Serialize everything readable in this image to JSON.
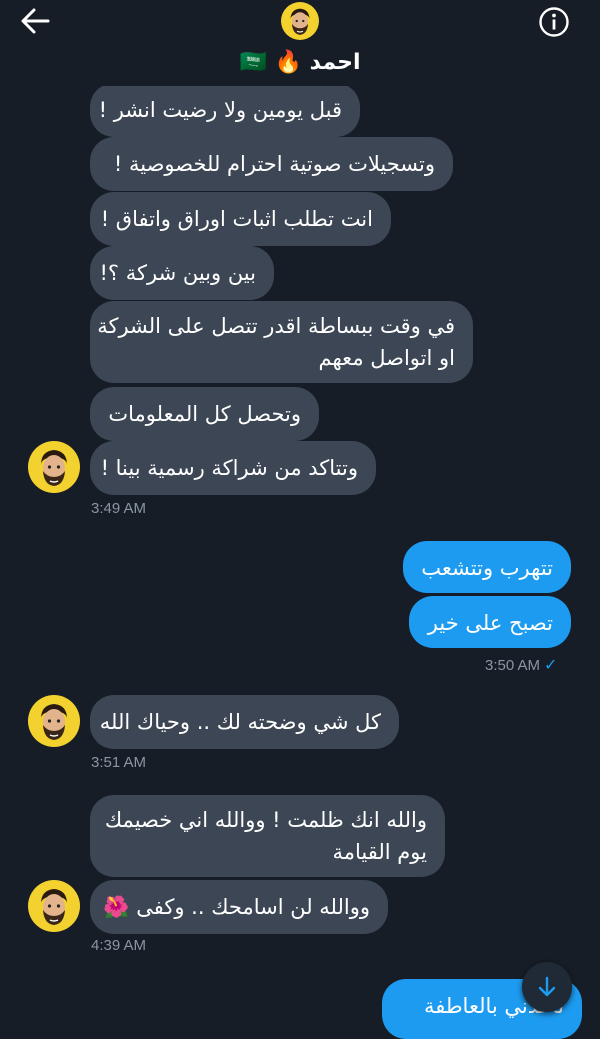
{
  "header": {
    "name": "احمد",
    "emojis": "🔥 🇸🇦",
    "back_icon": "arrow-left-icon",
    "info_icon": "info-circle-icon"
  },
  "messages": [
    {
      "dir": "in",
      "text": "قبل يومين ولا رضيت انشر !"
    },
    {
      "dir": "in",
      "text": "وتسجيلات صوتية احترام للخصوصية !"
    },
    {
      "dir": "in",
      "text": "انت تطلب اثبات اوراق واتفاق !"
    },
    {
      "dir": "in",
      "text": "بين وبين شركة ؟!"
    },
    {
      "dir": "in",
      "line1": "في وقت ببساطة اقدر تتصل على الشركة",
      "line2": "او اتواصل معهم"
    },
    {
      "dir": "in",
      "text": "وتحصل كل المعلومات"
    },
    {
      "dir": "in",
      "text": "وتتاكد من شراكة رسمية بينا !"
    },
    {
      "dir": "out",
      "text": "تتهرب وتتشعب"
    },
    {
      "dir": "out",
      "text": "تصبح على خير"
    },
    {
      "dir": "in",
      "text": "كل شي وضحته لك .. وحياك الله"
    },
    {
      "dir": "in",
      "line1": "والله انك ظلمت ! ووالله اني خصيمك",
      "line2": "يوم القيامة"
    },
    {
      "dir": "in",
      "text": "ووالله لن اسامحك .. وكفى 🌺"
    },
    {
      "dir": "out",
      "text": "تاخذني بالعاطفة"
    }
  ],
  "times": {
    "t1": "3:49 AM",
    "t2": "3:50 AM",
    "t3": "3:51 AM",
    "t4": "4:39 AM"
  },
  "read_check": "✓",
  "colors": {
    "background": "#161d26",
    "incoming": "#3c4654",
    "outgoing": "#1d9bf0",
    "time": "#8a96a3"
  }
}
